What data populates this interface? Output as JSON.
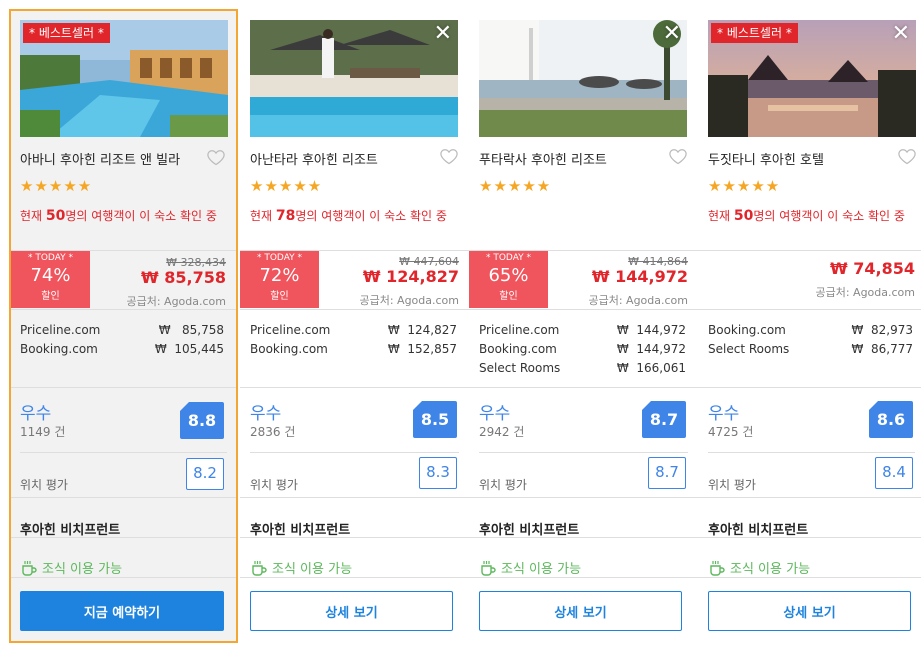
{
  "labels": {
    "bestseller": "* 베스트셀러 *",
    "today": "* TODAY *",
    "discount": "할인",
    "location_rating": "위치 평가",
    "breakfast": "조식 이용 가능"
  },
  "colors": {
    "accent_blue": "#1d83de",
    "price_red": "#e0252b",
    "deal_red": "#f0545c",
    "selected_border": "#f4a632",
    "breakfast_green": "#5cb85c",
    "star_gold": "#f5a623"
  },
  "cards": [
    {
      "badge": "* 베스트셀러 *",
      "name": "아바니 후아힌 리조트 앤 빌라",
      "stars": "★★★★★",
      "viewing_pre": "현재 ",
      "viewing_num": "50",
      "viewing_post": "명의 여행객이 이 숙소 확인 중",
      "deal_today": "* TODAY *",
      "discount_pct": "74%",
      "discount_label": "할인",
      "old_price": "₩ 328,434",
      "price": "₩ 85,758",
      "supplier": "공급처: Agoda.com",
      "offers": [
        {
          "site": "Priceline.com",
          "amount": "₩   85,758"
        },
        {
          "site": "Booking.com",
          "amount": "₩  105,445"
        }
      ],
      "rating_word": "우수",
      "reviews": "1149 건",
      "score": "8.8",
      "location_score": "8.2",
      "area": "후아힌 비치프런트",
      "button": "지금 예약하기"
    },
    {
      "name": "아난타라 후아힌 리조트",
      "stars": "★★★★★",
      "viewing_pre": "현재 ",
      "viewing_num": "78",
      "viewing_post": "명의 여행객이 이 숙소 확인 중",
      "deal_today": "* TODAY *",
      "discount_pct": "72%",
      "discount_label": "할인",
      "old_price": "₩ 447,604",
      "price": "₩ 124,827",
      "supplier": "공급처: Agoda.com",
      "offers": [
        {
          "site": "Priceline.com",
          "amount": "₩  124,827"
        },
        {
          "site": "Booking.com",
          "amount": "₩  152,857"
        }
      ],
      "rating_word": "우수",
      "reviews": "2836 건",
      "score": "8.5",
      "location_score": "8.3",
      "area": "후아힌 비치프런트",
      "button": "상세 보기"
    },
    {
      "name": "푸타락사 후아힌 리조트",
      "stars": "★★★★★",
      "deal_today": "* TODAY *",
      "discount_pct": "65%",
      "discount_label": "할인",
      "old_price": "₩ 414,864",
      "price": "₩ 144,972",
      "supplier": "공급처: Agoda.com",
      "offers": [
        {
          "site": "Priceline.com",
          "amount": "₩  144,972"
        },
        {
          "site": "Booking.com",
          "amount": "₩  144,972"
        },
        {
          "site": "Select Rooms",
          "amount": "₩  166,061"
        }
      ],
      "rating_word": "우수",
      "reviews": "2942 건",
      "score": "8.7",
      "location_score": "8.7",
      "area": "후아힌 비치프런트",
      "button": "상세 보기"
    },
    {
      "badge": "* 베스트셀러 *",
      "name": "두짓타니 후아힌 호텔",
      "stars": "★★★★★",
      "viewing_pre": "현재 ",
      "viewing_num": "50",
      "viewing_post": "명의 여행객이 이 숙소 확인 중",
      "price": "₩ 74,854",
      "supplier": "공급처: Agoda.com",
      "offers": [
        {
          "site": "Booking.com",
          "amount": "₩  82,973"
        },
        {
          "site": "Select Rooms",
          "amount": "₩  86,777"
        }
      ],
      "rating_word": "우수",
      "reviews": "4725 건",
      "score": "8.6",
      "location_score": "8.4",
      "area": "후아힌 비치프런트",
      "button": "상세 보기"
    }
  ]
}
